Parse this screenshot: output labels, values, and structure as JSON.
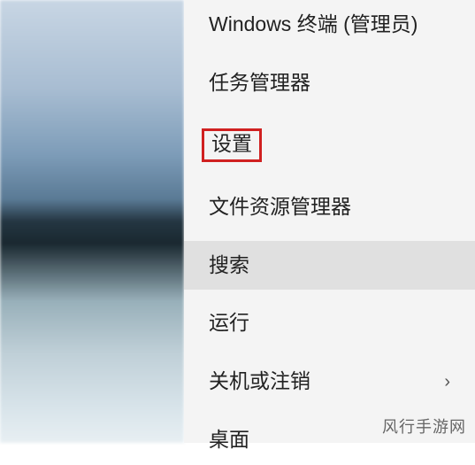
{
  "menu": {
    "items": [
      {
        "label": "Windows 终端 (管理员)"
      },
      {
        "label": "任务管理器"
      },
      {
        "label": "设置",
        "highlighted": true
      },
      {
        "label": "文件资源管理器"
      },
      {
        "label": "搜索",
        "hovered": true
      },
      {
        "label": "运行"
      },
      {
        "label": "关机或注销",
        "submenu": true
      },
      {
        "label": "桌面"
      }
    ]
  },
  "watermark": "风行手游网",
  "chevron_glyph": "›"
}
